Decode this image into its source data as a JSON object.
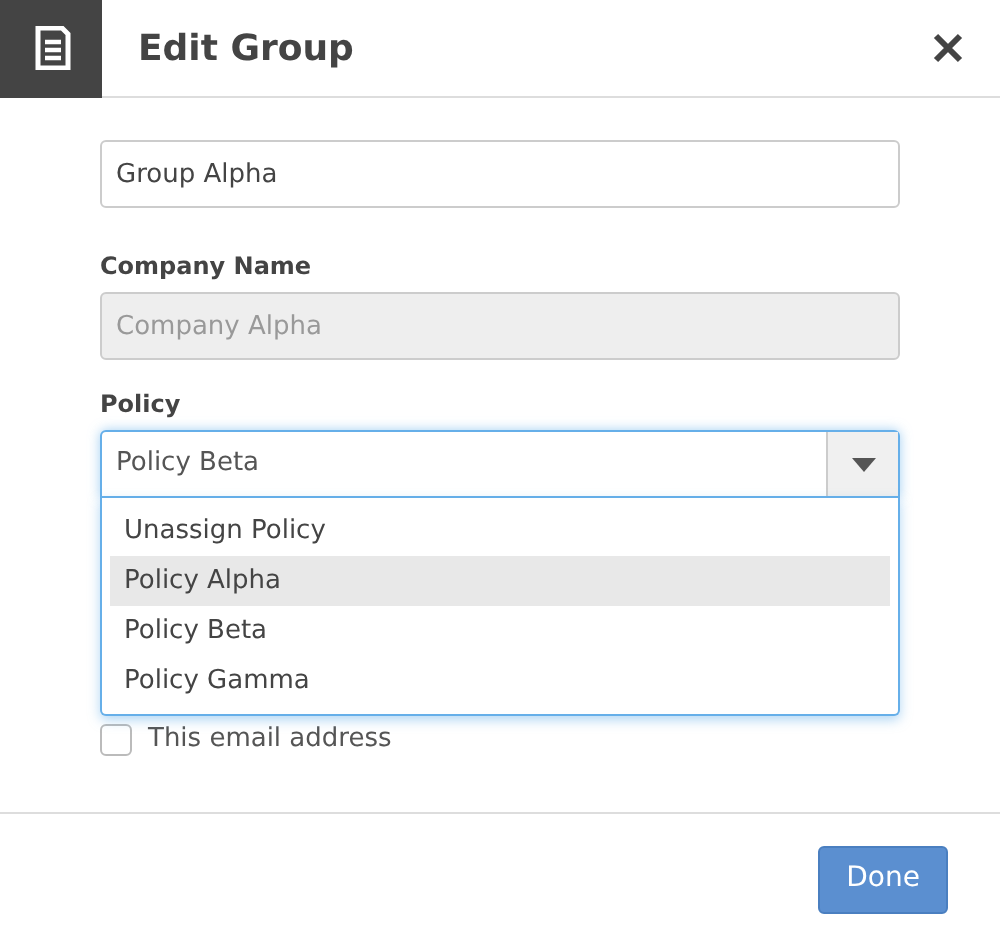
{
  "dialog": {
    "title": "Edit Group"
  },
  "name_field": {
    "value": "Group Alpha"
  },
  "company": {
    "label": "Company Name",
    "value": "Company Alpha",
    "disabled": true
  },
  "policy": {
    "label": "Policy",
    "value": "Policy Beta",
    "expanded": true,
    "options": [
      {
        "label": "Unassign Policy",
        "highlighted": false
      },
      {
        "label": "Policy Alpha",
        "highlighted": true
      },
      {
        "label": "Policy Beta",
        "highlighted": false
      },
      {
        "label": "Policy Gamma",
        "highlighted": false
      }
    ]
  },
  "email_checkbox": {
    "label": "This email address",
    "checked": false
  },
  "buttons": [
    {
      "label": "Done"
    }
  ]
}
